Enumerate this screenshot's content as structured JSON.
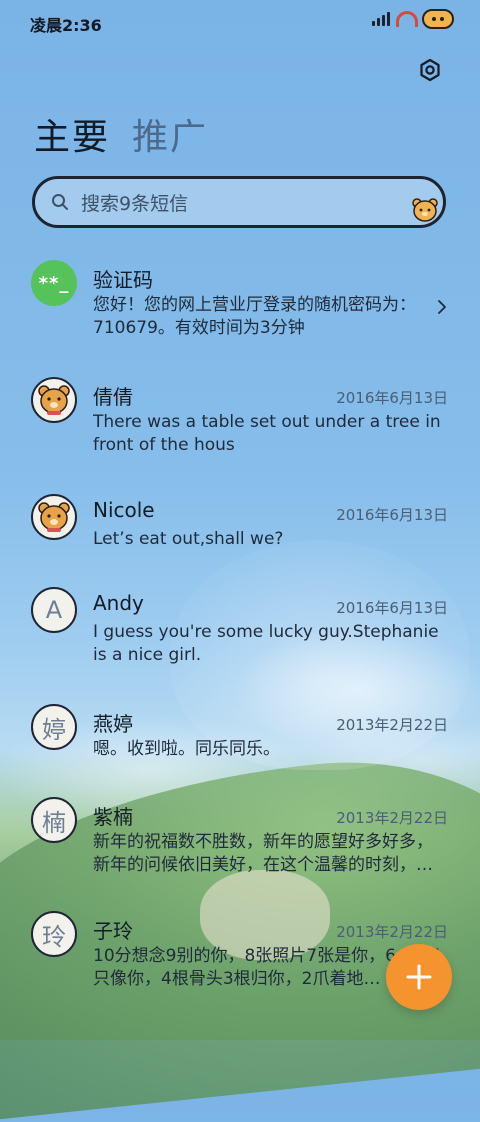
{
  "status_bar": {
    "time": "凌晨2:36"
  },
  "tabs": [
    {
      "label": "主要",
      "active": true
    },
    {
      "label": "推广",
      "active": false
    }
  ],
  "search": {
    "placeholder": "搜索9条短信"
  },
  "messages": [
    {
      "name": "验证码",
      "avatar_text": "**_",
      "date": "",
      "preview": "您好！您的网上营业厅登录的随机密码为：710679。有效时间为3分钟",
      "has_chevron": true
    },
    {
      "name": "倩倩",
      "avatar_text": "",
      "date": "2016年6月13日",
      "preview": "There was a table set out under a tree in front of the hous"
    },
    {
      "name": "Nicole",
      "avatar_text": "",
      "date": "2016年6月13日",
      "preview": "Let’s eat out,shall we?"
    },
    {
      "name": "Andy",
      "avatar_text": "A",
      "date": "2016年6月13日",
      "preview": "I guess you're some lucky guy.Stephanie is a nice girl."
    },
    {
      "name": "燕婷",
      "avatar_text": "婷",
      "date": "2013年2月22日",
      "preview": "嗯。收到啦。同乐同乐。"
    },
    {
      "name": "紫楠",
      "avatar_text": "楠",
      "date": "2013年2月22日",
      "preview": "新年的祝福数不胜数，新年的愿望好多好多，新年的问候依旧美好，在这个温馨的时刻，…"
    },
    {
      "name": "子玲",
      "avatar_text": "玲",
      "date": "2013年2月22日",
      "preview": "10分想念9别的你，8张照片7张是你，6…狗5只像你，4根骨头3根归你，2爪着地…"
    }
  ],
  "colors": {
    "accent": "#f5932f",
    "verify_avatar": "#56c35a"
  },
  "icons": [
    "settings-icon",
    "search-icon",
    "chevron-right-icon",
    "plus-icon"
  ]
}
